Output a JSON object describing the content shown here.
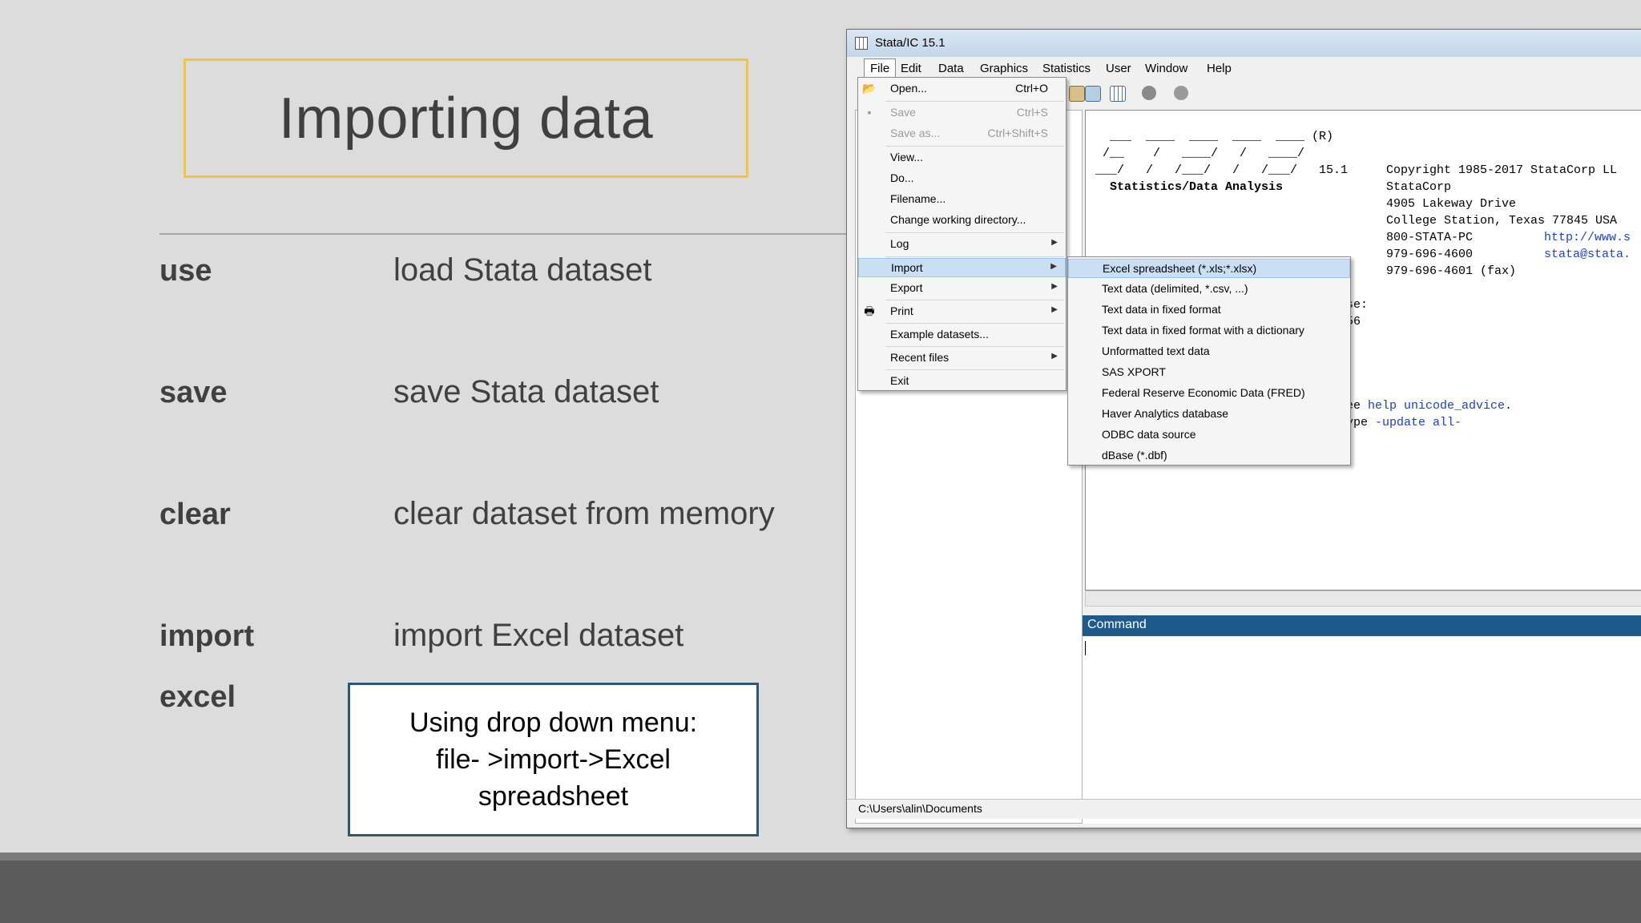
{
  "slide": {
    "title": "Importing data",
    "commands": [
      {
        "cmd": "use",
        "desc": "load Stata dataset"
      },
      {
        "cmd": "save",
        "desc": "save Stata dataset"
      },
      {
        "cmd": "clear",
        "desc": "clear dataset from memory"
      },
      {
        "cmd": "import",
        "cmd2": "excel",
        "desc": "import Excel dataset"
      }
    ],
    "note_lines": [
      "Using drop down menu:",
      "file- >import->Excel",
      "spreadsheet"
    ]
  },
  "stata": {
    "window_title": "Stata/IC 15.1",
    "menubar": [
      "File",
      "Edit",
      "Data",
      "Graphics",
      "Statistics",
      "User",
      "Window",
      "Help"
    ],
    "file_menu": [
      {
        "label": "Open...",
        "shortcut": "Ctrl+O",
        "icon": "open-folder-icon"
      },
      {
        "label": "Save",
        "shortcut": "Ctrl+S",
        "icon": "save-disk-icon",
        "disabled": true
      },
      {
        "label": "Save as...",
        "shortcut": "Ctrl+Shift+S",
        "disabled": true
      },
      {
        "label": "View..."
      },
      {
        "label": "Do..."
      },
      {
        "label": "Filename..."
      },
      {
        "label": "Change working directory..."
      },
      {
        "label": "Log",
        "submenu": true
      },
      {
        "label": "Import",
        "submenu": true,
        "highlighted": true
      },
      {
        "label": "Export",
        "submenu": true
      },
      {
        "label": "Print",
        "submenu": true,
        "icon": "printer-icon"
      },
      {
        "label": "Example datasets..."
      },
      {
        "label": "Recent files",
        "submenu": true
      },
      {
        "label": "Exit"
      }
    ],
    "import_submenu": [
      "Excel spreadsheet (*.xls;*.xlsx)",
      "Text data (delimited, *.csv, ...)",
      "Text data in fixed format",
      "Text data in fixed format with a dictionary",
      "Unformatted text data",
      "SAS XPORT",
      "Federal Reserve Economic Data (FRED)",
      "Haver Analytics database",
      "ODBC data source",
      "dBase (*.dbf)"
    ],
    "results": {
      "logo_lines": [
        "  ___  ____  ____  ____  ____ (R)",
        " /__    /   ____/   /   ____/",
        "___/   /   /___/   /   /___/   15.1",
        "  Statistics/Data Analysis"
      ],
      "copyright_lines": [
        "Copyright 1985-2017 StataCorp LL",
        "StataCorp",
        "4905 Lakeway Drive",
        "College Station, Texas 77845 USA",
        "800-STATA-PC",
        "979-696-4600",
        "979-696-4601 (fax)"
      ],
      "url_text": "http://www.s",
      "email_text": "stata@stata.",
      "partial_lines": [
        "se:",
        "56"
      ],
      "help_prefix": "ee ",
      "help_link": "help unicode_advice",
      "help_suffix": ".",
      "update_prefix": "ype ",
      "update_link": "-update all-"
    },
    "command_label": "Command",
    "status_path": "C:\\Users\\alin\\Documents"
  }
}
